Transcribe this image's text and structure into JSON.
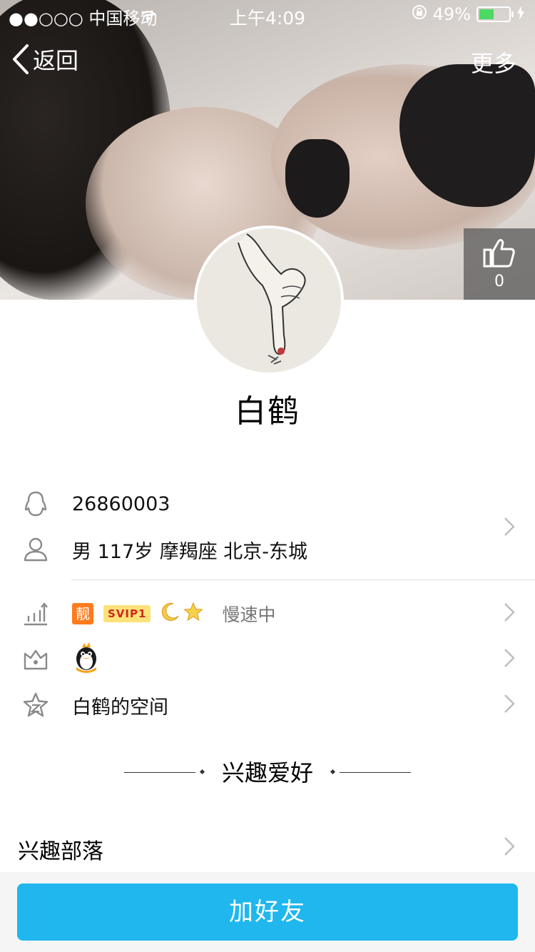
{
  "status_bar": {
    "carrier": "●●○○○ 中国移动",
    "time": "上午4:09",
    "battery_percent": "49%",
    "battery_level": 0.49
  },
  "nav": {
    "back_label": "返回",
    "more_label": "更多"
  },
  "like": {
    "count": "0"
  },
  "profile": {
    "name": "白鹤"
  },
  "info": {
    "qq_number": "26860003",
    "personal": "男 117岁 摩羯座 北京-东城",
    "level_badge_liang": "靓",
    "level_badge_svip": "SVIP1",
    "level_speed": "慢速中",
    "space_label": "白鹤的空间"
  },
  "section": {
    "title": "兴趣爱好"
  },
  "interest": {
    "label": "兴趣部落"
  },
  "bottom": {
    "add_friend_label": "加好友"
  },
  "colors": {
    "accent": "#1fb7ee",
    "battery": "#4cd964",
    "liang_badge": "#ff7b1c",
    "svip_badge": "#fde27a"
  }
}
